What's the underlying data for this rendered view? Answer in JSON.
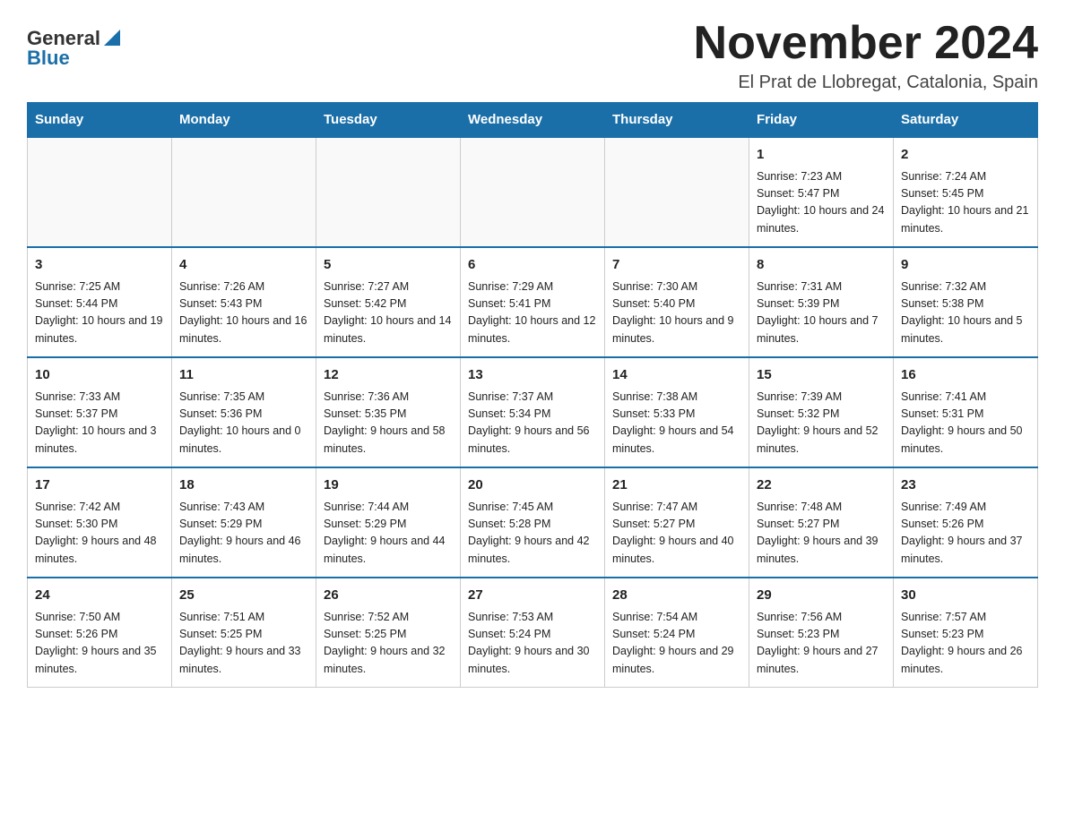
{
  "header": {
    "logo_general": "General",
    "logo_blue": "Blue",
    "title": "November 2024",
    "subtitle": "El Prat de Llobregat, Catalonia, Spain"
  },
  "calendar": {
    "days_of_week": [
      "Sunday",
      "Monday",
      "Tuesday",
      "Wednesday",
      "Thursday",
      "Friday",
      "Saturday"
    ],
    "weeks": [
      {
        "days": [
          {
            "number": "",
            "info": ""
          },
          {
            "number": "",
            "info": ""
          },
          {
            "number": "",
            "info": ""
          },
          {
            "number": "",
            "info": ""
          },
          {
            "number": "",
            "info": ""
          },
          {
            "number": "1",
            "info": "Sunrise: 7:23 AM\nSunset: 5:47 PM\nDaylight: 10 hours and 24 minutes."
          },
          {
            "number": "2",
            "info": "Sunrise: 7:24 AM\nSunset: 5:45 PM\nDaylight: 10 hours and 21 minutes."
          }
        ]
      },
      {
        "days": [
          {
            "number": "3",
            "info": "Sunrise: 7:25 AM\nSunset: 5:44 PM\nDaylight: 10 hours and 19 minutes."
          },
          {
            "number": "4",
            "info": "Sunrise: 7:26 AM\nSunset: 5:43 PM\nDaylight: 10 hours and 16 minutes."
          },
          {
            "number": "5",
            "info": "Sunrise: 7:27 AM\nSunset: 5:42 PM\nDaylight: 10 hours and 14 minutes."
          },
          {
            "number": "6",
            "info": "Sunrise: 7:29 AM\nSunset: 5:41 PM\nDaylight: 10 hours and 12 minutes."
          },
          {
            "number": "7",
            "info": "Sunrise: 7:30 AM\nSunset: 5:40 PM\nDaylight: 10 hours and 9 minutes."
          },
          {
            "number": "8",
            "info": "Sunrise: 7:31 AM\nSunset: 5:39 PM\nDaylight: 10 hours and 7 minutes."
          },
          {
            "number": "9",
            "info": "Sunrise: 7:32 AM\nSunset: 5:38 PM\nDaylight: 10 hours and 5 minutes."
          }
        ]
      },
      {
        "days": [
          {
            "number": "10",
            "info": "Sunrise: 7:33 AM\nSunset: 5:37 PM\nDaylight: 10 hours and 3 minutes."
          },
          {
            "number": "11",
            "info": "Sunrise: 7:35 AM\nSunset: 5:36 PM\nDaylight: 10 hours and 0 minutes."
          },
          {
            "number": "12",
            "info": "Sunrise: 7:36 AM\nSunset: 5:35 PM\nDaylight: 9 hours and 58 minutes."
          },
          {
            "number": "13",
            "info": "Sunrise: 7:37 AM\nSunset: 5:34 PM\nDaylight: 9 hours and 56 minutes."
          },
          {
            "number": "14",
            "info": "Sunrise: 7:38 AM\nSunset: 5:33 PM\nDaylight: 9 hours and 54 minutes."
          },
          {
            "number": "15",
            "info": "Sunrise: 7:39 AM\nSunset: 5:32 PM\nDaylight: 9 hours and 52 minutes."
          },
          {
            "number": "16",
            "info": "Sunrise: 7:41 AM\nSunset: 5:31 PM\nDaylight: 9 hours and 50 minutes."
          }
        ]
      },
      {
        "days": [
          {
            "number": "17",
            "info": "Sunrise: 7:42 AM\nSunset: 5:30 PM\nDaylight: 9 hours and 48 minutes."
          },
          {
            "number": "18",
            "info": "Sunrise: 7:43 AM\nSunset: 5:29 PM\nDaylight: 9 hours and 46 minutes."
          },
          {
            "number": "19",
            "info": "Sunrise: 7:44 AM\nSunset: 5:29 PM\nDaylight: 9 hours and 44 minutes."
          },
          {
            "number": "20",
            "info": "Sunrise: 7:45 AM\nSunset: 5:28 PM\nDaylight: 9 hours and 42 minutes."
          },
          {
            "number": "21",
            "info": "Sunrise: 7:47 AM\nSunset: 5:27 PM\nDaylight: 9 hours and 40 minutes."
          },
          {
            "number": "22",
            "info": "Sunrise: 7:48 AM\nSunset: 5:27 PM\nDaylight: 9 hours and 39 minutes."
          },
          {
            "number": "23",
            "info": "Sunrise: 7:49 AM\nSunset: 5:26 PM\nDaylight: 9 hours and 37 minutes."
          }
        ]
      },
      {
        "days": [
          {
            "number": "24",
            "info": "Sunrise: 7:50 AM\nSunset: 5:26 PM\nDaylight: 9 hours and 35 minutes."
          },
          {
            "number": "25",
            "info": "Sunrise: 7:51 AM\nSunset: 5:25 PM\nDaylight: 9 hours and 33 minutes."
          },
          {
            "number": "26",
            "info": "Sunrise: 7:52 AM\nSunset: 5:25 PM\nDaylight: 9 hours and 32 minutes."
          },
          {
            "number": "27",
            "info": "Sunrise: 7:53 AM\nSunset: 5:24 PM\nDaylight: 9 hours and 30 minutes."
          },
          {
            "number": "28",
            "info": "Sunrise: 7:54 AM\nSunset: 5:24 PM\nDaylight: 9 hours and 29 minutes."
          },
          {
            "number": "29",
            "info": "Sunrise: 7:56 AM\nSunset: 5:23 PM\nDaylight: 9 hours and 27 minutes."
          },
          {
            "number": "30",
            "info": "Sunrise: 7:57 AM\nSunset: 5:23 PM\nDaylight: 9 hours and 26 minutes."
          }
        ]
      }
    ]
  }
}
